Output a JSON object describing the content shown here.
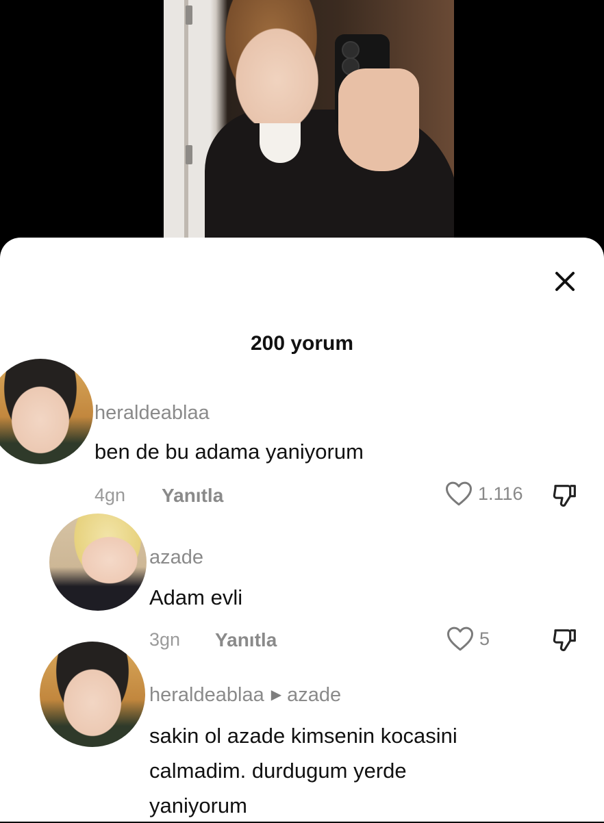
{
  "sheet": {
    "title": "200 yorum"
  },
  "comments": [
    {
      "username": "heraldeablaa",
      "text": "ben de bu adama yaniyorum",
      "time": "4gn",
      "reply_label": "Yanıtla",
      "likes": "1.116"
    },
    {
      "username": "azade",
      "text": "Adam evli",
      "time": "3gn",
      "reply_label": "Yanıtla",
      "likes": "5"
    },
    {
      "username": "heraldeablaa",
      "reply_to": "azade",
      "text_lines": [
        "sakin ol azade kimsenin kocasini",
        "calmadim. durdugum yerde",
        "yaniyorum"
      ]
    }
  ],
  "icons": {
    "close": "close-icon",
    "like": "heart-icon",
    "dislike": "thumbs-down-icon",
    "reply_arrow": "caret-right-icon"
  },
  "colors": {
    "username": "#8a8a8a",
    "text": "#111111",
    "background": "#ffffff"
  }
}
